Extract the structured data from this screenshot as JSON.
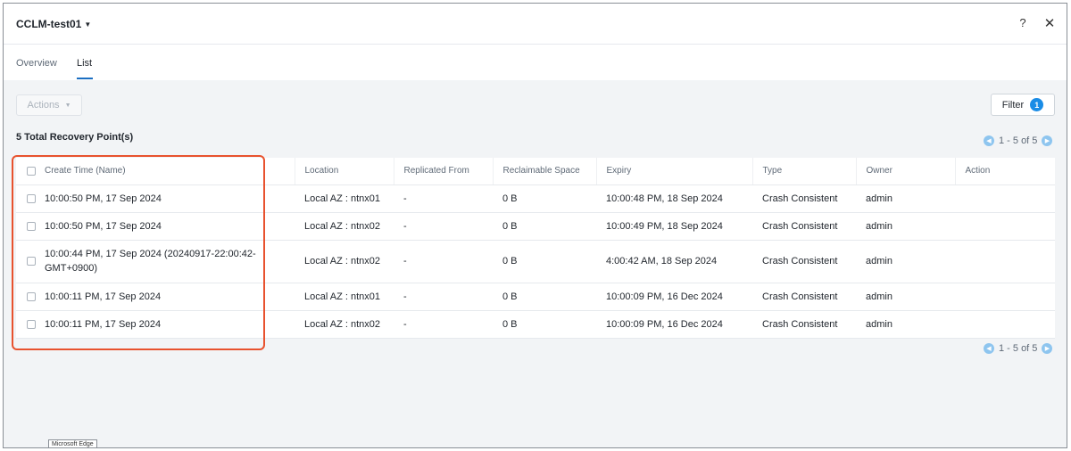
{
  "header": {
    "entity_name": "CCLM-test01",
    "help_symbol": "?",
    "close_symbol": "✕"
  },
  "tabs": [
    {
      "label": "Overview"
    },
    {
      "label": "List"
    }
  ],
  "toolbar": {
    "actions_label": "Actions",
    "filter_label": "Filter",
    "filter_count": "1"
  },
  "summary": {
    "total_label": "5 Total Recovery Point(s)"
  },
  "pagination": {
    "range_label": "1 - 5 of 5"
  },
  "table": {
    "columns": [
      "Create Time (Name)",
      "Location",
      "Replicated From",
      "Reclaimable Space",
      "Expiry",
      "Type",
      "Owner",
      "Action"
    ],
    "rows": [
      {
        "name": "10:00:50 PM, 17 Sep 2024",
        "location": "Local AZ : ntnx01",
        "replicated_from": "-",
        "reclaimable": "0 B",
        "expiry": "10:00:48 PM, 18 Sep 2024",
        "type": "Crash Consistent",
        "owner": "admin",
        "action": ""
      },
      {
        "name": "10:00:50 PM, 17 Sep 2024",
        "location": "Local AZ : ntnx02",
        "replicated_from": "-",
        "reclaimable": "0 B",
        "expiry": "10:00:49 PM, 18 Sep 2024",
        "type": "Crash Consistent",
        "owner": "admin",
        "action": ""
      },
      {
        "name": "10:00:44 PM, 17 Sep 2024 (20240917-22:00:42-GMT+0900)",
        "location": "Local AZ : ntnx02",
        "replicated_from": "-",
        "reclaimable": "0 B",
        "expiry": "4:00:42 AM, 18 Sep 2024",
        "type": "Crash Consistent",
        "owner": "admin",
        "action": ""
      },
      {
        "name": "10:00:11 PM, 17 Sep 2024",
        "location": "Local AZ : ntnx01",
        "replicated_from": "-",
        "reclaimable": "0 B",
        "expiry": "10:00:09 PM, 16 Dec 2024",
        "type": "Crash Consistent",
        "owner": "admin",
        "action": ""
      },
      {
        "name": "10:00:11 PM, 17 Sep 2024",
        "location": "Local AZ : ntnx02",
        "replicated_from": "-",
        "reclaimable": "0 B",
        "expiry": "10:00:09 PM, 16 Dec 2024",
        "type": "Crash Consistent",
        "owner": "admin",
        "action": ""
      }
    ]
  },
  "tooltip": {
    "label": "Microsoft Edge"
  },
  "colors": {
    "accent": "#1a8ce6",
    "highlight": "#e8522e",
    "tab_underline": "#1b6ec2"
  }
}
